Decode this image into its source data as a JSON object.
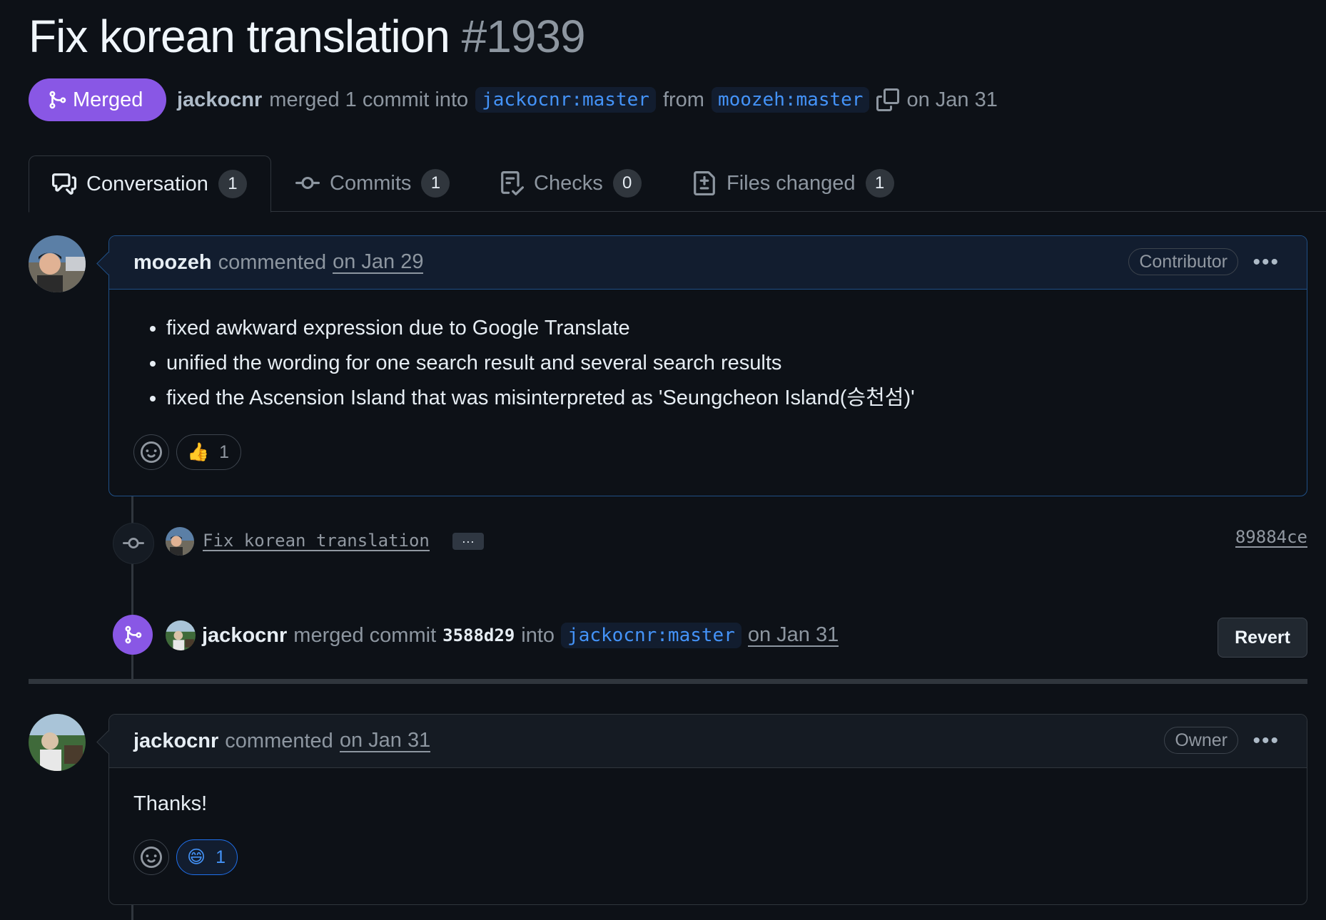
{
  "pr": {
    "title": "Fix korean translation",
    "number": "#1939",
    "state_label": "Merged",
    "merger": "jackocnr",
    "merge_text": "merged 1 commit into",
    "base_branch": "jackocnr:master",
    "from_text": "from",
    "head_branch": "moozeh:master",
    "merged_date": "on Jan 31"
  },
  "tabs": [
    {
      "label": "Conversation",
      "count": "1",
      "icon": "comment-discussion-icon"
    },
    {
      "label": "Commits",
      "count": "1",
      "icon": "git-commit-icon"
    },
    {
      "label": "Checks",
      "count": "0",
      "icon": "checklist-icon"
    },
    {
      "label": "Files changed",
      "count": "1",
      "icon": "file-diff-icon"
    }
  ],
  "comment1": {
    "author": "moozeh",
    "action": "commented",
    "date": "on Jan 29",
    "role": "Contributor",
    "items": [
      "fixed awkward expression due to Google Translate",
      "unified the wording for one search result and several search results",
      "fixed the Ascension Island that was misinterpreted as 'Seungcheon Island(승천섬)'"
    ],
    "reaction_emoji": "👍",
    "reaction_count": "1"
  },
  "commit": {
    "message": "Fix korean translation",
    "more": "···",
    "sha": "89884ce"
  },
  "merge_event": {
    "author": "jackocnr",
    "text": "merged commit",
    "sha": "3588d29",
    "into_text": "into",
    "branch": "jackocnr:master",
    "date": "on Jan 31",
    "revert_label": "Revert"
  },
  "comment2": {
    "author": "jackocnr",
    "action": "commented",
    "date": "on Jan 31",
    "role": "Owner",
    "body": "Thanks!",
    "reaction_emoji": "😄",
    "reaction_count": "1"
  },
  "colors": {
    "background": "#0d1117",
    "merged_purple": "#8957e5",
    "link_blue": "#4493f8",
    "border": "#30363d"
  }
}
